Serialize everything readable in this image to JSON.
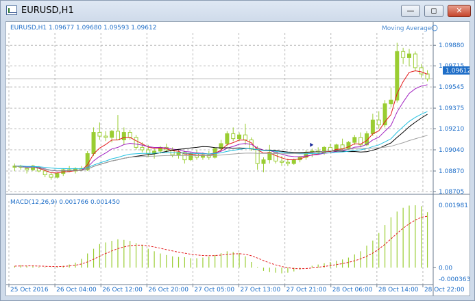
{
  "window": {
    "title": "EURUSD,H1",
    "minimize_icon": "minimize-icon",
    "restore_icon": "restore-icon",
    "close_icon": "close-icon"
  },
  "main_panel": {
    "header": "EURUSD,H1  1.09677 1.09680 1.09593 1.09612",
    "indicator_label": "Moving Average",
    "current_price": "1.09612"
  },
  "macd_panel": {
    "header": "MACD(12,26,9) 0.001766 0.001450"
  },
  "colors": {
    "bull": "#9acd32",
    "ma_fast": "#e41a1c",
    "ma_mid": "#a020c0",
    "ma_black": "#000000",
    "ma_cyan": "#20c0e0",
    "ma_gray": "#a0a0a0",
    "text": "#1e6ec8"
  },
  "chart_data": {
    "type": "line",
    "price_axis": {
      "ticks": [
        "1.09880",
        "1.09715",
        "1.09545",
        "1.09375",
        "1.09210",
        "1.09040",
        "1.08870",
        "1.08705"
      ],
      "ylim": [
        1.08705,
        1.0998
      ],
      "current": 1.09612,
      "top_tick": "1.09880"
    },
    "macd_axis": {
      "ticks": [
        "0.001981",
        "0.00",
        "-0.000363"
      ]
    },
    "time_axis": [
      "25 Oct 2016",
      "26 Oct 04:00",
      "26 Oct 12:00",
      "26 Oct 20:00",
      "27 Oct 05:00",
      "27 Oct 13:00",
      "27 Oct 21:00",
      "28 Oct 06:00",
      "28 Oct 14:00",
      "28 Oct 22:00"
    ],
    "ohlc": [
      [
        1.089,
        1.0893,
        1.0887,
        1.0891
      ],
      [
        1.0891,
        1.0892,
        1.0888,
        1.089
      ],
      [
        1.0889,
        1.089,
        1.0885,
        1.0888
      ],
      [
        1.0888,
        1.0892,
        1.0887,
        1.0891
      ],
      [
        1.089,
        1.0891,
        1.0886,
        1.0887
      ],
      [
        1.0887,
        1.0888,
        1.0882,
        1.0884
      ],
      [
        1.0884,
        1.0886,
        1.088,
        1.0882
      ],
      [
        1.0882,
        1.0886,
        1.0881,
        1.0885
      ],
      [
        1.0885,
        1.0889,
        1.0883,
        1.0888
      ],
      [
        1.0888,
        1.0891,
        1.0886,
        1.0887
      ],
      [
        1.0887,
        1.089,
        1.0885,
        1.0889
      ],
      [
        1.0889,
        1.0891,
        1.0887,
        1.0888
      ],
      [
        1.0888,
        1.0903,
        1.0887,
        1.0901
      ],
      [
        1.0901,
        1.0922,
        1.0899,
        1.0918
      ],
      [
        1.0918,
        1.0926,
        1.0912,
        1.0915
      ],
      [
        1.0915,
        1.0919,
        1.0911,
        1.0914
      ],
      [
        1.0914,
        1.092,
        1.091,
        1.0919
      ],
      [
        1.0919,
        1.0932,
        1.0916,
        1.0912
      ],
      [
        1.0912,
        1.0922,
        1.0908,
        1.0918
      ],
      [
        1.0918,
        1.092,
        1.0912,
        1.0914
      ],
      [
        1.0914,
        1.0916,
        1.0904,
        1.0906
      ],
      [
        1.0906,
        1.091,
        1.0902,
        1.0904
      ],
      [
        1.0904,
        1.0908,
        1.0898,
        1.0901
      ],
      [
        1.0901,
        1.0905,
        1.0897,
        1.0903
      ],
      [
        1.0903,
        1.0907,
        1.0901,
        1.0906
      ],
      [
        1.0906,
        1.0909,
        1.0902,
        1.0904
      ],
      [
        1.0904,
        1.0906,
        1.0898,
        1.09
      ],
      [
        1.09,
        1.0904,
        1.0897,
        1.0902
      ],
      [
        1.0902,
        1.0903,
        1.0893,
        1.0896
      ],
      [
        1.0896,
        1.0902,
        1.0895,
        1.0901
      ],
      [
        1.0901,
        1.0904,
        1.0896,
        1.0898
      ],
      [
        1.0898,
        1.0902,
        1.0896,
        1.09
      ],
      [
        1.09,
        1.0903,
        1.0896,
        1.0898
      ],
      [
        1.0898,
        1.0906,
        1.0897,
        1.0905
      ],
      [
        1.0905,
        1.0912,
        1.0903,
        1.0909
      ],
      [
        1.0909,
        1.0919,
        1.0907,
        1.0917
      ],
      [
        1.0917,
        1.0922,
        1.0911,
        1.0913
      ],
      [
        1.0913,
        1.0918,
        1.0911,
        1.0916
      ],
      [
        1.0916,
        1.0925,
        1.0908,
        1.0912
      ],
      [
        1.0912,
        1.0914,
        1.0903,
        1.0905
      ],
      [
        1.0905,
        1.0907,
        1.0888,
        1.0893
      ],
      [
        1.0893,
        1.0898,
        1.0886,
        1.0896
      ],
      [
        1.0896,
        1.0908,
        1.0893,
        1.0902
      ],
      [
        1.0902,
        1.0904,
        1.0893,
        1.0895
      ],
      [
        1.0895,
        1.0899,
        1.0891,
        1.0894
      ],
      [
        1.0894,
        1.0897,
        1.0891,
        1.0893
      ],
      [
        1.0893,
        1.0897,
        1.0892,
        1.0896
      ],
      [
        1.0896,
        1.0899,
        1.0894,
        1.0898
      ],
      [
        1.0898,
        1.0904,
        1.0896,
        1.0902
      ],
      [
        1.0902,
        1.0905,
        1.0898,
        1.0903
      ],
      [
        1.0903,
        1.0906,
        1.09,
        1.0902
      ],
      [
        1.0902,
        1.0907,
        1.09,
        1.0906
      ],
      [
        1.0906,
        1.0909,
        1.0902,
        1.0903
      ],
      [
        1.0903,
        1.0909,
        1.0902,
        1.0908
      ],
      [
        1.0908,
        1.0913,
        1.0904,
        1.0905
      ],
      [
        1.0905,
        1.0911,
        1.0904,
        1.091
      ],
      [
        1.091,
        1.0916,
        1.0908,
        1.0914
      ],
      [
        1.0914,
        1.0918,
        1.0906,
        1.0908
      ],
      [
        1.0908,
        1.0919,
        1.0907,
        1.0917
      ],
      [
        1.0917,
        1.0933,
        1.0915,
        1.0928
      ],
      [
        1.0928,
        1.0935,
        1.0921,
        1.0924
      ],
      [
        1.0924,
        1.0944,
        1.0922,
        1.0941
      ],
      [
        1.0941,
        1.0954,
        1.0938,
        1.0944
      ],
      [
        1.0944,
        1.099,
        1.0942,
        1.0983
      ],
      [
        1.0983,
        1.0986,
        1.0973,
        1.0978
      ],
      [
        1.0978,
        1.0985,
        1.0971,
        1.0981
      ],
      [
        1.0981,
        1.0983,
        1.0967,
        1.097
      ],
      [
        1.097,
        1.0973,
        1.0962,
        1.0965
      ],
      [
        1.0965,
        1.0968,
        1.0959,
        1.0961
      ]
    ],
    "macd_hist": [
      5e-05,
      8e-05,
      6e-05,
      6e-05,
      3e-05,
      2e-05,
      1e-05,
      3e-05,
      6e-05,
      0.0001,
      0.00016,
      0.00028,
      0.00045,
      0.0006,
      0.00075,
      0.0008,
      0.00085,
      0.0009,
      0.00088,
      0.00085,
      0.00078,
      0.00072,
      0.0006,
      0.00052,
      0.00045,
      0.0004,
      0.00036,
      0.00034,
      0.00033,
      0.0003,
      0.0003,
      0.00032,
      0.00035,
      0.0004,
      0.00046,
      0.00052,
      0.0005,
      0.00046,
      0.00036,
      0.00018,
      2e-05,
      -0.0001,
      -0.00014,
      -0.00016,
      -0.00018,
      -0.00016,
      -0.00012,
      -6e-05,
      0.0,
      6e-05,
      0.0001,
      0.00014,
      0.00018,
      0.00022,
      0.00026,
      0.00032,
      0.00042,
      0.00052,
      0.0007,
      0.00086,
      0.0011,
      0.00135,
      0.0016,
      0.00178,
      0.0019,
      0.00197,
      0.00198,
      0.00195,
      0.00176
    ]
  }
}
